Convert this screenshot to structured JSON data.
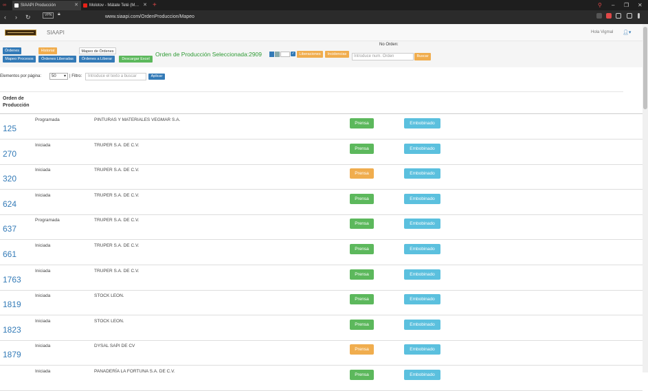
{
  "browser": {
    "tabs": [
      {
        "label": "SIAAPI Producción"
      },
      {
        "label": "Molotov - Mátate Teté (M…"
      }
    ],
    "url": "www.siaapi.com/OrdenProduccion/Mapeo",
    "vpn_label": "VPN"
  },
  "header": {
    "app_name": "SIAAPI",
    "greeting": "Hola Vigmal"
  },
  "toolbar": {
    "ordenes": "Órdenes",
    "mapeo_procesos": "Mapeo Procesos",
    "historial": "Historial",
    "ordenes_liberadas": "Órdenes Liberadas",
    "mapeo_ordenes": "Mapeo de Órdenes",
    "ordenes_liberar": "Órdenes a Liberar",
    "descargar_excel": "Descargar Excel",
    "selected_order": "Orden de Producción Seleccionada:2909",
    "liberaciones": "Liberaciones",
    "incidencias": "Incidencias",
    "no_orden_label": "No Orden:",
    "order_input_placeholder": "Introduce num. Orden",
    "buscar": "Buscar"
  },
  "filters": {
    "per_page_label": "Elementos por página:",
    "per_page_value": "50",
    "filter_label": "| Filtro:",
    "filter_placeholder": "Introduce el texto a buscar",
    "apply": "Aplicar"
  },
  "table": {
    "column_header_line1": "Orden de",
    "column_header_line2": "Producción",
    "rows": [
      {
        "order": "125",
        "status": "Programada",
        "client": "PINTURAS Y MATERIALES VEGMAR S.A.",
        "prensa": "Prensa",
        "prensa_state": "green",
        "embobinado": "Embobinado"
      },
      {
        "order": "270",
        "status": "Iniciada",
        "client": "TRUPER S.A. DE C.V.",
        "prensa": "Prensa",
        "prensa_state": "green",
        "embobinado": "Embobinado"
      },
      {
        "order": "320",
        "status": "Iniciada",
        "client": "TRUPER S.A. DE C.V.",
        "prensa": "Prensa",
        "prensa_state": "orange",
        "embobinado": "Embobinado"
      },
      {
        "order": "624",
        "status": "Iniciada",
        "client": "TRUPER S.A. DE C.V.",
        "prensa": "Prensa",
        "prensa_state": "green",
        "embobinado": "Embobinado"
      },
      {
        "order": "637",
        "status": "Programada",
        "client": "TRUPER S.A. DE C.V.",
        "prensa": "Prensa",
        "prensa_state": "green",
        "embobinado": "Embobinado"
      },
      {
        "order": "661",
        "status": "Iniciada",
        "client": "TRUPER S.A. DE C.V.",
        "prensa": "Prensa",
        "prensa_state": "green",
        "embobinado": "Embobinado"
      },
      {
        "order": "1763",
        "status": "Iniciada",
        "client": "TRUPER S.A. DE C.V.",
        "prensa": "Prensa",
        "prensa_state": "green",
        "embobinado": "Embobinado"
      },
      {
        "order": "1819",
        "status": "Iniciada",
        "client": "STOCK LEON.",
        "prensa": "Prensa",
        "prensa_state": "green",
        "embobinado": "Embobinado"
      },
      {
        "order": "1823",
        "status": "Iniciada",
        "client": "STOCK LEON.",
        "prensa": "Prensa",
        "prensa_state": "green",
        "embobinado": "Embobinado"
      },
      {
        "order": "1879",
        "status": "Iniciada",
        "client": "DYSAL SAPI DE CV",
        "prensa": "Prensa",
        "prensa_state": "orange",
        "embobinado": "Embobinado"
      },
      {
        "order": "",
        "status": "Iniciada",
        "client": "PANADERÍA LA FORTUNA S.A. DE C.V.",
        "prensa": "Prensa",
        "prensa_state": "green",
        "embobinado": "Embobinado"
      }
    ]
  },
  "colors": {
    "primary": "#337ab7",
    "success": "#5cb85c",
    "warning": "#f0ad4e",
    "info": "#5bc0de",
    "selected_order_text": "#2e9a34"
  }
}
